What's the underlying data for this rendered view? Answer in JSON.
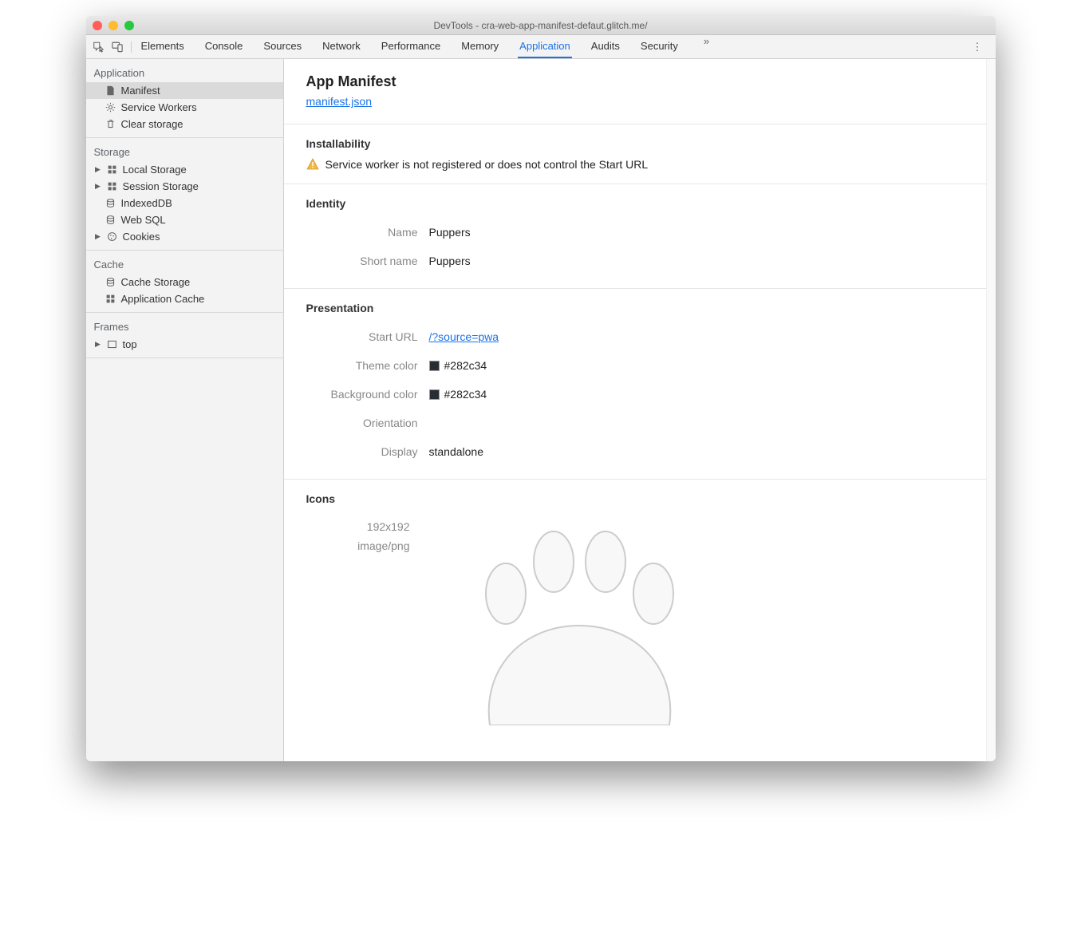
{
  "window": {
    "title": "DevTools - cra-web-app-manifest-defaut.glitch.me/"
  },
  "tabs": [
    {
      "label": "Elements"
    },
    {
      "label": "Console"
    },
    {
      "label": "Sources"
    },
    {
      "label": "Network"
    },
    {
      "label": "Performance"
    },
    {
      "label": "Memory"
    },
    {
      "label": "Application",
      "active": true
    },
    {
      "label": "Audits"
    },
    {
      "label": "Security"
    }
  ],
  "overflow": "»",
  "sidebar": {
    "application": {
      "header": "Application",
      "items": [
        {
          "label": "Manifest",
          "icon": "file",
          "selected": true
        },
        {
          "label": "Service Workers",
          "icon": "gear"
        },
        {
          "label": "Clear storage",
          "icon": "trash"
        }
      ]
    },
    "storage": {
      "header": "Storage",
      "items": [
        {
          "label": "Local Storage",
          "icon": "grid",
          "expandable": true
        },
        {
          "label": "Session Storage",
          "icon": "grid",
          "expandable": true
        },
        {
          "label": "IndexedDB",
          "icon": "db"
        },
        {
          "label": "Web SQL",
          "icon": "db"
        },
        {
          "label": "Cookies",
          "icon": "cookie",
          "expandable": true
        }
      ]
    },
    "cache": {
      "header": "Cache",
      "items": [
        {
          "label": "Cache Storage",
          "icon": "db"
        },
        {
          "label": "Application Cache",
          "icon": "grid"
        }
      ]
    },
    "frames": {
      "header": "Frames",
      "items": [
        {
          "label": "top",
          "icon": "frame",
          "expandable": true
        }
      ]
    }
  },
  "main": {
    "title": "App Manifest",
    "manifest_link": "manifest.json",
    "installability": {
      "header": "Installability",
      "warning": "Service worker is not registered or does not control the Start URL"
    },
    "identity": {
      "header": "Identity",
      "name_label": "Name",
      "name_value": "Puppers",
      "shortname_label": "Short name",
      "shortname_value": "Puppers"
    },
    "presentation": {
      "header": "Presentation",
      "starturl_label": "Start URL",
      "starturl_value": "/?source=pwa",
      "themecolor_label": "Theme color",
      "themecolor_value": "#282c34",
      "bgcolor_label": "Background color",
      "bgcolor_value": "#282c34",
      "orientation_label": "Orientation",
      "orientation_value": "",
      "display_label": "Display",
      "display_value": "standalone"
    },
    "icons": {
      "header": "Icons",
      "size": "192x192",
      "mime": "image/png"
    }
  }
}
